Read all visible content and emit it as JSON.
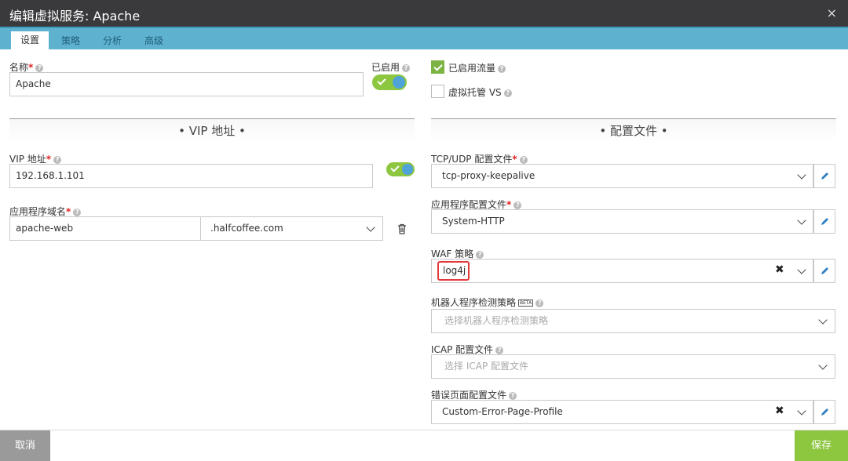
{
  "dialog": {
    "title": "编辑虚拟服务: Apache",
    "close": "×"
  },
  "tabs": [
    {
      "label": "设置",
      "active": true
    },
    {
      "label": "策略"
    },
    {
      "label": "分析"
    },
    {
      "label": "高级"
    }
  ],
  "general": {
    "name_label": "名称",
    "name_value": "Apache",
    "enabled_label": "已启用",
    "traffic_label": "已启用流量",
    "traffic_checked": true,
    "vh_label": "虚拟托管 VS",
    "vh_checked": false
  },
  "vip": {
    "section_title": "• VIP 地址 •",
    "address_label": "VIP 地址",
    "address_value": "192.168.1.101",
    "domain_label": "应用程序域名",
    "domain_prefix": "apache-web",
    "domain_suffix": ".halfcoffee.com"
  },
  "profiles": {
    "section_title": "• 配置文件 •",
    "tcp_label": "TCP/UDP 配置文件",
    "tcp_value": "tcp-proxy-keepalive",
    "app_label": "应用程序配置文件",
    "app_value": "System-HTTP",
    "waf_label": "WAF 策略",
    "waf_value": "log4j",
    "bot_label": "机器人程序检测策略",
    "bot_beta": "BETA",
    "bot_placeholder": "选择机器人程序检测策略",
    "icap_label": "ICAP 配置文件",
    "icap_placeholder": "选择 ICAP 配置文件",
    "error_label": "错误页面配置文件",
    "error_value": "Custom-Error-Page-Profile"
  },
  "footer": {
    "cancel": "取消",
    "save": "保存"
  },
  "colors": {
    "accent": "#5fb2cf",
    "toggle_on": "#8dc63f",
    "save": "#8dc63f",
    "cancel": "#9a9a9a",
    "titlebar": "#3a3a3c",
    "highlight": "#e23b3b"
  }
}
